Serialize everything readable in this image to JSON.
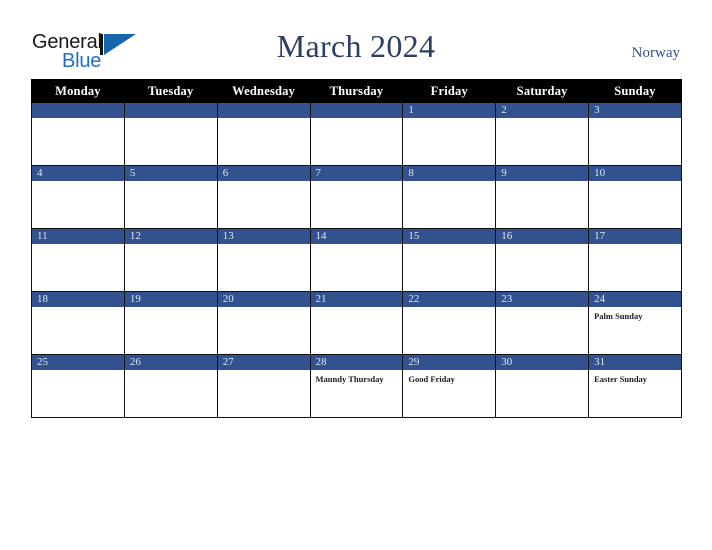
{
  "brand": {
    "word_one": "General",
    "word_two": "Blue",
    "mark": "triangle-logo"
  },
  "header": {
    "title": "March 2024",
    "country": "Norway"
  },
  "colors": {
    "date_bar_blue": "#31528f",
    "header_black": "#000000",
    "title_navy": "#2c3e63",
    "country_navy": "#31518c",
    "brand_blue": "#1f6fc4"
  },
  "calendar": {
    "weekday_headers": [
      "Monday",
      "Tuesday",
      "Wednesday",
      "Thursday",
      "Friday",
      "Saturday",
      "Sunday"
    ],
    "weeks": [
      [
        {
          "day": "",
          "events": []
        },
        {
          "day": "",
          "events": []
        },
        {
          "day": "",
          "events": []
        },
        {
          "day": "",
          "events": []
        },
        {
          "day": "1",
          "events": []
        },
        {
          "day": "2",
          "events": []
        },
        {
          "day": "3",
          "events": []
        }
      ],
      [
        {
          "day": "4",
          "events": []
        },
        {
          "day": "5",
          "events": []
        },
        {
          "day": "6",
          "events": []
        },
        {
          "day": "7",
          "events": []
        },
        {
          "day": "8",
          "events": []
        },
        {
          "day": "9",
          "events": []
        },
        {
          "day": "10",
          "events": []
        }
      ],
      [
        {
          "day": "11",
          "events": []
        },
        {
          "day": "12",
          "events": []
        },
        {
          "day": "13",
          "events": []
        },
        {
          "day": "14",
          "events": []
        },
        {
          "day": "15",
          "events": []
        },
        {
          "day": "16",
          "events": []
        },
        {
          "day": "17",
          "events": []
        }
      ],
      [
        {
          "day": "18",
          "events": []
        },
        {
          "day": "19",
          "events": []
        },
        {
          "day": "20",
          "events": []
        },
        {
          "day": "21",
          "events": []
        },
        {
          "day": "22",
          "events": []
        },
        {
          "day": "23",
          "events": []
        },
        {
          "day": "24",
          "events": [
            "Palm Sunday"
          ]
        }
      ],
      [
        {
          "day": "25",
          "events": []
        },
        {
          "day": "26",
          "events": []
        },
        {
          "day": "27",
          "events": []
        },
        {
          "day": "28",
          "events": [
            "Maundy Thursday"
          ]
        },
        {
          "day": "29",
          "events": [
            "Good Friday"
          ]
        },
        {
          "day": "30",
          "events": []
        },
        {
          "day": "31",
          "events": [
            "Easter Sunday"
          ]
        }
      ]
    ]
  }
}
